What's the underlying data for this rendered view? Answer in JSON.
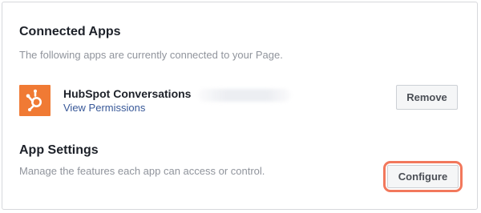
{
  "connected_apps": {
    "title": "Connected Apps",
    "description": "The following apps are currently connected to your Page."
  },
  "app": {
    "name": "HubSpot Conversations",
    "link_label": "View Permissions",
    "logo_color": "#f07a34",
    "logo_icon": "hubspot-sprocket-icon"
  },
  "actions": {
    "remove_label": "Remove",
    "configure_label": "Configure",
    "highlight_color": "#f2785c"
  },
  "app_settings": {
    "title": "App Settings",
    "description": "Manage the features each app can access or control."
  }
}
